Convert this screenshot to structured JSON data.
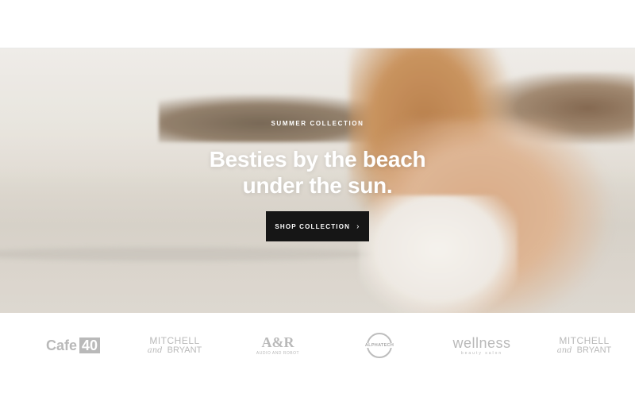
{
  "hero": {
    "eyebrow": "SUMMER COLLECTION",
    "headline_line1": "Besties by the beach",
    "headline_line2": "under the sun.",
    "cta_label": "SHOP COLLECTION",
    "cta_icon": "chevron-right-icon"
  },
  "brands": {
    "cafe40": {
      "text": "Cafe",
      "badge": "40"
    },
    "mitchell_bryant": {
      "line1": "MITCHELL",
      "and": "and",
      "line2": "BRYANT"
    },
    "ar": {
      "text": "A&R",
      "tagline": "AUDIO AND ROBOT"
    },
    "alphatech": {
      "text": "ALPHATECH"
    },
    "wellness": {
      "text": "wellness",
      "tagline": "beauty salon"
    }
  },
  "colors": {
    "cta_background": "#161616",
    "logo_gray": "#b9b9b9"
  }
}
